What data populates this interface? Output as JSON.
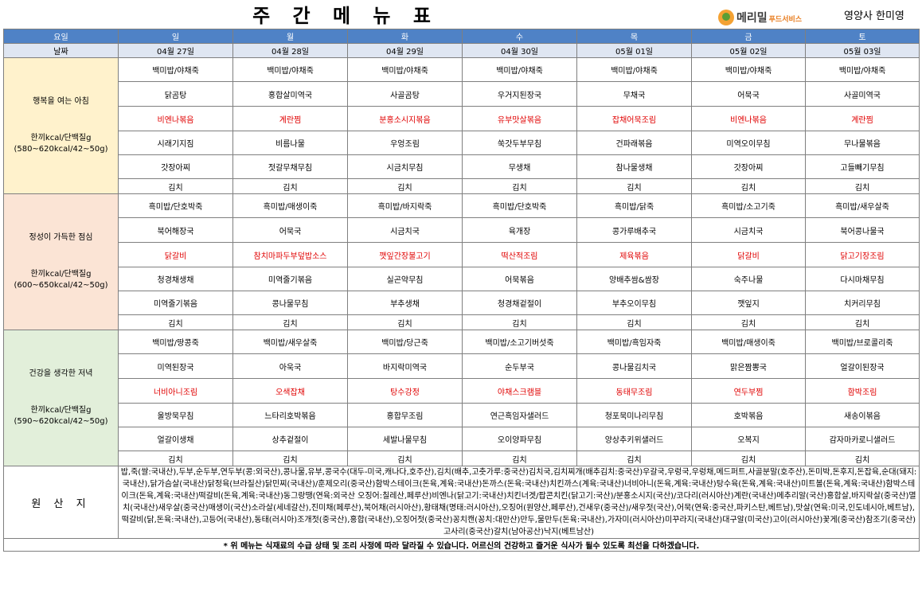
{
  "title": "주 간 메 뉴 표",
  "brand": {
    "name": "메리밀",
    "sub": "푸드서비스"
  },
  "dietitian": "영양사 한미영",
  "header": {
    "day_label": "요일",
    "date_label": "날짜",
    "days": [
      "일",
      "월",
      "화",
      "수",
      "목",
      "금",
      "토"
    ],
    "dates": [
      "04월 27일",
      "04월 28일",
      "04월 29일",
      "04월 30일",
      "05월 01일",
      "05월 02일",
      "05월 03일"
    ]
  },
  "breakfast": {
    "title": "행복을 여는 아침",
    "kcal": "한끼kcal/단백질g",
    "range": "(580~620kcal/42~50g)",
    "rows": [
      [
        "백미밥/야채죽",
        "백미밥/야채죽",
        "백미밥/야채죽",
        "백미밥/야채죽",
        "백미밥/야채죽",
        "백미밥/야채죽",
        "백미밥/야채죽"
      ],
      [
        "닭곰탕",
        "홍합살미역국",
        "사골곰탕",
        "우거지된장국",
        "무채국",
        "어묵국",
        "사골미역국"
      ],
      [
        "비엔나볶음",
        "계란찜",
        "분홍소시지볶음",
        "유부맛살볶음",
        "잡채어묵조림",
        "비엔나볶음",
        "계란찜"
      ],
      [
        "시래기지짐",
        "비름나물",
        "우엉조림",
        "쑥갓두부무침",
        "건파래볶음",
        "미역오이무침",
        "무나물볶음"
      ],
      [
        "갓장아찌",
        "젓갈무채무침",
        "시금치무침",
        "무생채",
        "참나물생채",
        "갓장아찌",
        "고들빼기무침"
      ],
      [
        "김치",
        "김치",
        "김치",
        "김치",
        "김치",
        "김치",
        "김치"
      ]
    ]
  },
  "lunch": {
    "title": "정성이 가득한 점심",
    "kcal": "한끼kcal/단백질g",
    "range": "(600~650kcal/42~50g)",
    "rows": [
      [
        "흑미밥/단호박죽",
        "흑미밥/매생이죽",
        "흑미밥/바지락죽",
        "흑미밥/단호박죽",
        "흑미밥/닭죽",
        "흑미밥/소고기죽",
        "흑미밥/새우살죽"
      ],
      [
        "북어해장국",
        "어묵국",
        "시금치국",
        "육개장",
        "콩가루배추국",
        "시금치국",
        "북어콩나물국"
      ],
      [
        "닭갈비",
        "참치마파두부덮밥소스",
        "깻잎간장불고기",
        "떡산적조림",
        "제육볶음",
        "닭갈비",
        "닭고기장조림"
      ],
      [
        "청경채생채",
        "미역줄기볶음",
        "실곤약무침",
        "어묵볶음",
        "양배추쌈&쌈장",
        "숙주나물",
        "다시마채무침"
      ],
      [
        "미역줄기볶음",
        "콩나물무침",
        "부추생채",
        "청경채겉절이",
        "부추오이무침",
        "깻잎지",
        "치커리무침"
      ],
      [
        "김치",
        "김치",
        "김치",
        "김치",
        "김치",
        "김치",
        "김치"
      ]
    ]
  },
  "dinner": {
    "title": "건강을 생각한 저녁",
    "kcal": "한끼kcal/단백질g",
    "range": "(590~620kcal/42~50g)",
    "rows": [
      [
        "백미밥/땅콩죽",
        "백미밥/새우살죽",
        "백미밥/당근죽",
        "백미밥/소고기버섯죽",
        "백미밥/흑임자죽",
        "백미밥/매생이죽",
        "백미밥/브로콜리죽"
      ],
      [
        "미역된장국",
        "아욱국",
        "바지락미역국",
        "순두부국",
        "콩나물김치국",
        "맑은짬뽕국",
        "얼갈이된장국"
      ],
      [
        "너비아니조림",
        "오색잡채",
        "탕수강정",
        "야채스크램블",
        "동태무조림",
        "연두부찜",
        "함박조림"
      ],
      [
        "울방묵무침",
        "느타리호박볶음",
        "홍합무조림",
        "연근흑임자샐러드",
        "청포묵미나리무침",
        "호박볶음",
        "새송이볶음"
      ],
      [
        "얼갈이생채",
        "상추겉절이",
        "세발나물무침",
        "오이양파무침",
        "양상추키위샐러드",
        "오복지",
        "감자마카로니샐러드"
      ],
      [
        "김치",
        "김치",
        "김치",
        "김치",
        "김치",
        "김치",
        "김치"
      ]
    ]
  },
  "origin": {
    "label": "원 산 지",
    "text": "밥,죽(쌀:국내산),두부,순두부,연두부(콩:외국산),콩나물,유부,콩국수(대두-미국,캐나다,호주산),김치(배추,고춧가루:중국산)김치국,김치찌개(배추김치:중국산)우갈국,우렁국,우렁채,메드퍼트,사골분말(호주산),돈미박,돈후지,돈잡육,순대(돼지:국내산),닭가슴살(국내산)닭정육(브라질산)닭민찌(국내산)/훈제오리(중국산)함박스테이크(돈육,계육:국내산)돈까스(돈육:국내산)치킨까스(계육:국내산)너비아니(돈육,계육:국내산)탕수육(돈육,계육:국내산)미트볼(돈육,계육:국내산)함박스테이크(돈육,계육:국내산)떡갈비(돈육,계육:국내산)동그랑땡(연육:외국산 오징어:칠레산,페루산)비엔나(닭고기:국내산)치킨너겟/팝콘치킨(닭고기:국산)/분홍소시지(국산)/코다리(러시아산)계란(국내산)메추리알(국산)홍합살,바지락살(중국산)멸치(국내산)새우살(중국산)매생이(국산)소라살(세네갈산),진미채(페루산),북어채(러시아산),황태채(명태:러시아산),오징어(원양산,페루산),건새우(중국산)/새우젓(국산),어묵(연육:중국산,파키스탄,베트남),맛살(연육:미국,인도네시아,베트남),떡갈비(닭,돈육:국내산),고등어(국내산),동태(러시아)조개젓(중국산),홍합(국내산),오징어젓(중국산)꽁치캔(꽁치:대만산)만두,물만두(돈육:국내산),가자미(러시아산)미꾸라지(국내산)대구알(미국산)고이(러시아산)꽃게(중국산)참조기(중국산)고사리(중국산)갈치(남아공산)낙지(베트남산)"
  },
  "note": "* 위 메뉴는 식재료의 수급 상태 및 조리 사정에 따라 달라질 수 있습니다. 어르신의 건강하고 즐거운 식사가 될수 있도록 최선을 다하겠습니다.",
  "colors": {
    "day_header": "#4f82c6",
    "breakfast": "#fff2cc",
    "lunch": "#fbe4d5",
    "dinner": "#e2efda",
    "highlight": "#e00000"
  }
}
